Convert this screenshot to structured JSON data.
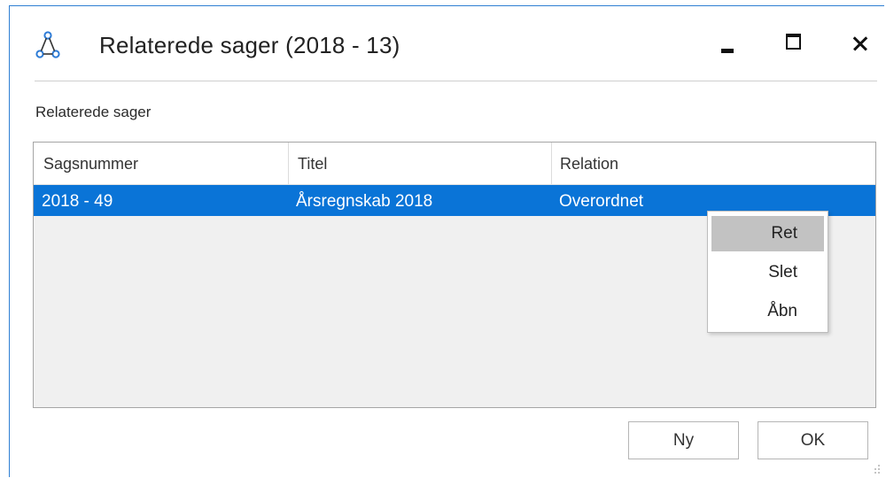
{
  "window": {
    "title": "Relaterede sager (2018 - 13)",
    "icon": "related-cases-icon",
    "controls": [
      "minimize-icon",
      "maximize-icon",
      "close-icon"
    ]
  },
  "section_label": "Relaterede sager",
  "grid": {
    "columns": [
      "Sagsnummer",
      "Titel",
      "Relation"
    ],
    "rows": [
      {
        "sagsnummer": "2018 - 49",
        "titel": "Årsregnskab 2018",
        "relation": "Overordnet",
        "selected": true
      }
    ]
  },
  "context_menu": {
    "items": [
      "Ret",
      "Slet",
      "Åbn"
    ],
    "highlighted": "Ret"
  },
  "buttons": {
    "new": "Ny",
    "ok": "OK"
  },
  "colors": {
    "selection": "#0a74d7",
    "window_border": "#2f7fd3",
    "menu_highlight": "#c2c2c2",
    "grid_background": "#f0f0f0"
  }
}
